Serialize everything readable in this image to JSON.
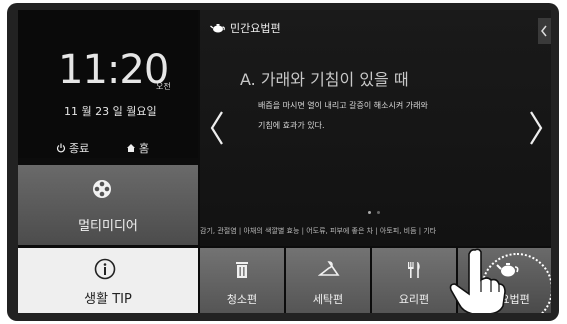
{
  "clock": {
    "time": "11:20",
    "ampm": "오전",
    "date": "11 월 23 일  월요일"
  },
  "controls": {
    "power_label": "종료",
    "home_label": "홈"
  },
  "left_menu": {
    "multimedia_label": "멀티미디어",
    "tip_label": "생활 TIP"
  },
  "content": {
    "section_title": "민간요법편",
    "heading": "A. 가래와 기침이 있을 때",
    "body_line1": "배즙을 마시면 열이 내리고 갈증이 해소시켜 가래와",
    "body_line2": "기침에 효과가 있다.",
    "ticker": "감기, 관절염 | 아채의 색깔별 효능 | 어도류, 피부에 좋은 차 | 아토피, 비듬 | 기타"
  },
  "tabs": [
    {
      "label": "청소편",
      "icon": "trash-icon"
    },
    {
      "label": "세탁편",
      "icon": "hanger-icon"
    },
    {
      "label": "요리편",
      "icon": "utensils-icon"
    },
    {
      "label": "민간요법편",
      "icon": "teapot-icon"
    }
  ],
  "colors": {
    "screen_bg": "#0c0c0c",
    "tab_bg": "#646464",
    "tip_bg": "#efefef"
  }
}
